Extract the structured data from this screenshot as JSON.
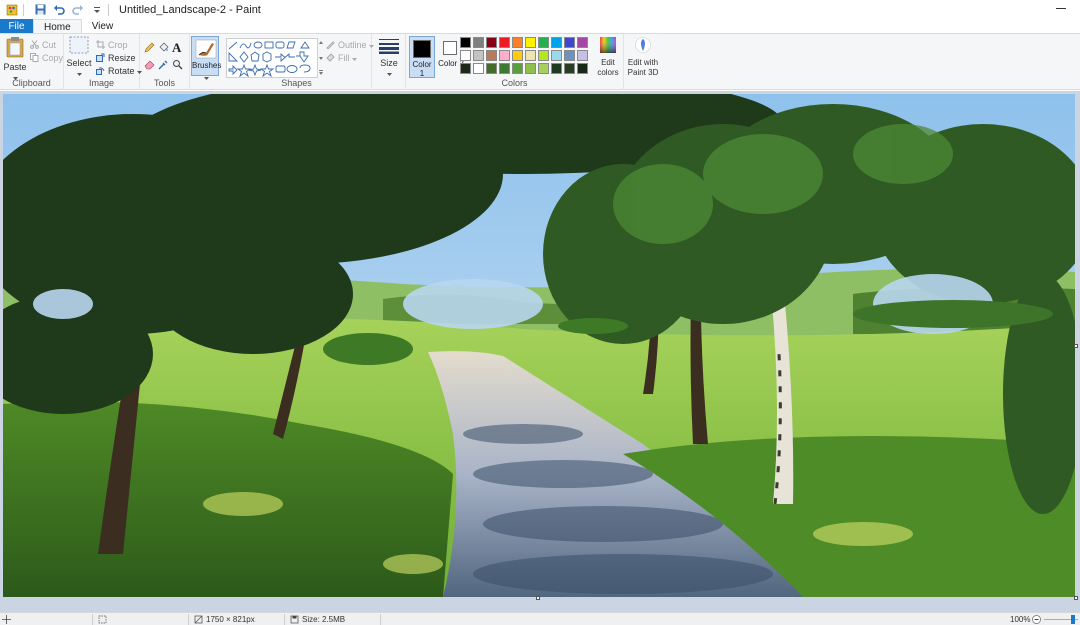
{
  "window": {
    "title": "Untitled_Landscape-2 - Paint"
  },
  "tabs": [
    {
      "label": "File"
    },
    {
      "label": "Home"
    },
    {
      "label": "View"
    }
  ],
  "clipboard": {
    "group_label": "Clipboard",
    "paste": "Paste",
    "cut": "Cut",
    "copy": "Copy"
  },
  "image": {
    "group_label": "Image",
    "select": "Select",
    "crop": "Crop",
    "resize": "Resize",
    "rotate": "Rotate"
  },
  "tools": {
    "group_label": "Tools",
    "text_glyph": "A"
  },
  "brushes": {
    "label": "Brushes"
  },
  "shapes": {
    "group_label": "Shapes",
    "outline": "Outline",
    "fill": "Fill"
  },
  "size": {
    "label": "Size"
  },
  "colors": {
    "group_label": "Colors",
    "color1": "Color 1",
    "color2": "Color 2",
    "edit_colors": "Edit colors",
    "edit_paint3d": "Edit with Paint 3D",
    "color1_value": "#000000",
    "color2_value": "#ffffff",
    "palette_row1": [
      "#000000",
      "#7f7f7f",
      "#880015",
      "#ed1c24",
      "#ff7f27",
      "#fff200",
      "#22b14c",
      "#00a2e8",
      "#3f48cc",
      "#a349a4"
    ],
    "palette_row2": [
      "#ffffff",
      "#c3c3c3",
      "#b97a57",
      "#ffaec9",
      "#ffc90e",
      "#efe4b0",
      "#b5e61d",
      "#99d9ea",
      "#7092be",
      "#c8bfe7"
    ],
    "palette_row3": [
      "#1d2a1a",
      "#ffffff",
      "#446b2a",
      "#3d7a30",
      "#58a03a",
      "#8fc04e",
      "#a9cf5d",
      "#1f3a22",
      "#2a3d24",
      "#182818"
    ]
  },
  "status": {
    "dimensions": "1750 × 821px",
    "size": "Size: 2.5MB",
    "zoom": "100%"
  }
}
